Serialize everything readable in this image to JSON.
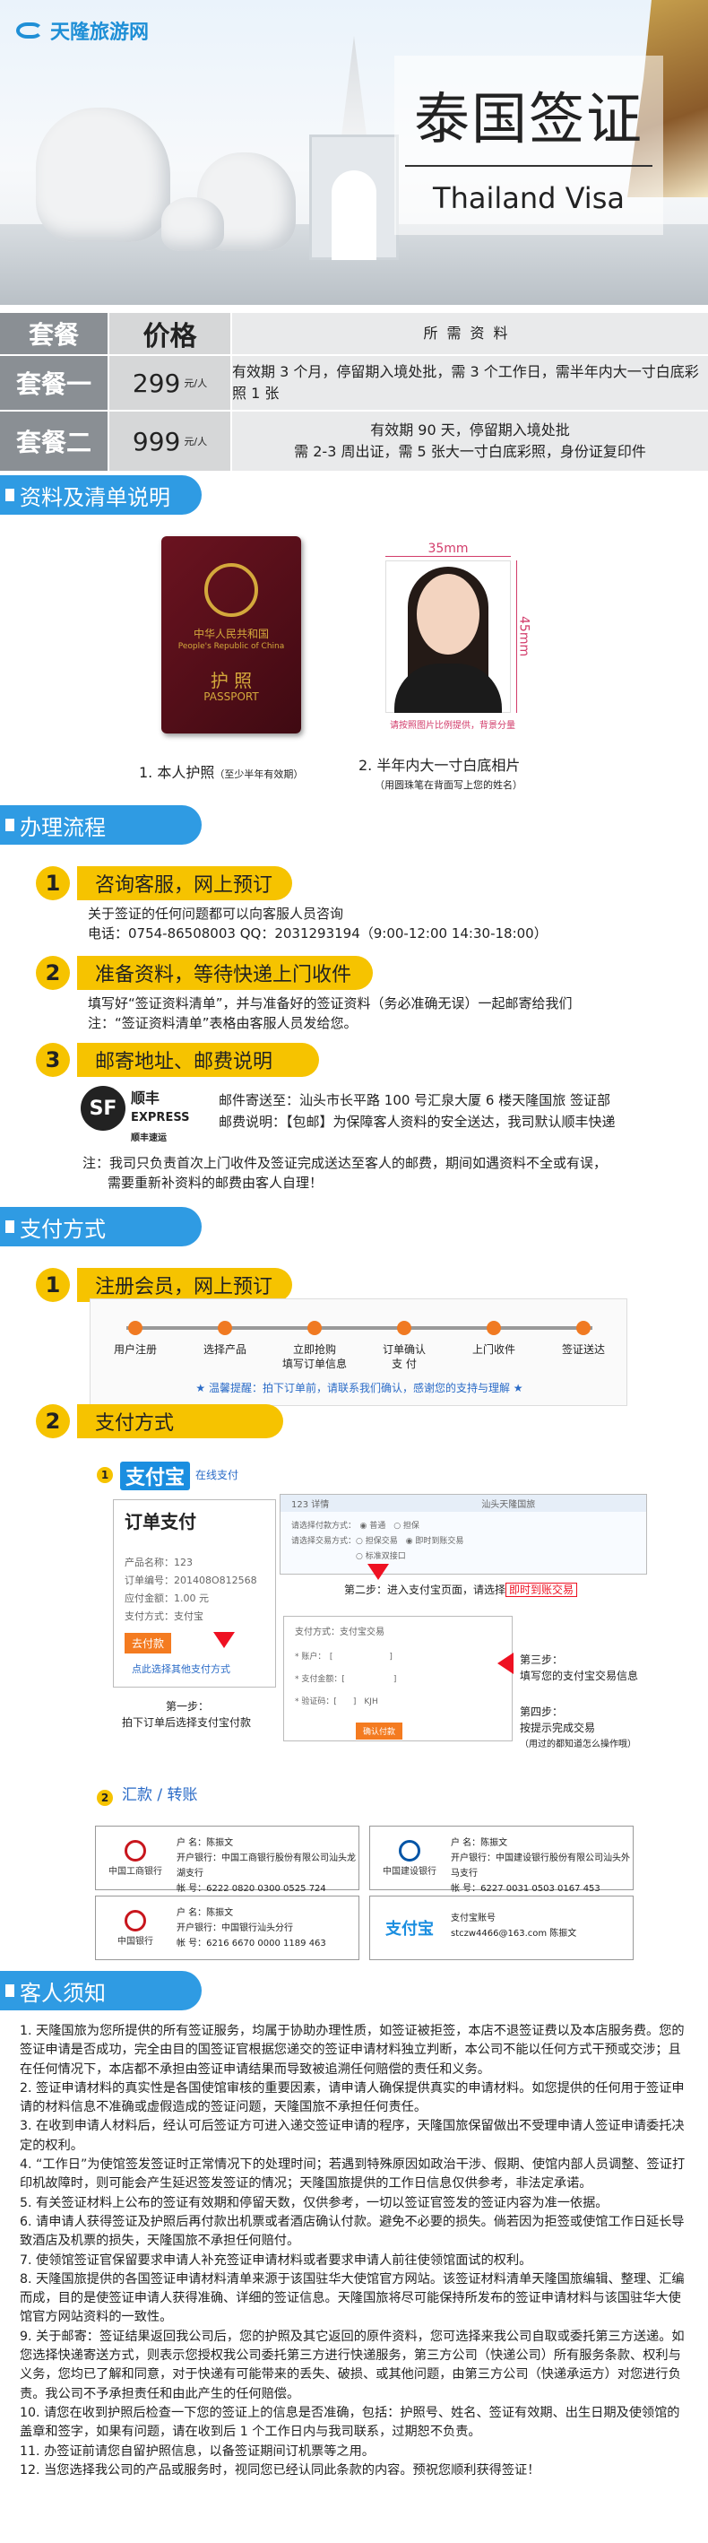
{
  "header": {
    "logo_text": "天隆旅游网",
    "title_cn": "泰国签证",
    "title_en": "Thailand Visa"
  },
  "price_table": {
    "headers": [
      "套餐",
      "价格",
      "所需资料"
    ],
    "rows": [
      {
        "name": "套餐一",
        "price": "299",
        "unit": "元/人",
        "materials": [
          "有效期 3 个月，停留期入境处批，需 3 个工作日，需半年内大一寸白底彩照 1 张"
        ]
      },
      {
        "name": "套餐二",
        "price": "999",
        "unit": "元/人",
        "materials": [
          "有效期 90 天，停留期入境处批",
          "需 2-3 周出证，需 5 张大一寸白底彩照，身份证复印件"
        ]
      }
    ]
  },
  "section1": {
    "title": "资料及清单说明",
    "passport_label_cn": "中华人民共和国",
    "passport_label_en": "People's Republic of China",
    "passport_word": "护 照",
    "passport_word_en": "PASSPORT",
    "photo_width": "35mm",
    "photo_height": "45mm",
    "photo_note": "请按照图片比例提供，背景分量",
    "cap1": "1. 本人护照",
    "cap1_small": "（至少半年有效期）",
    "cap2": "2. 半年内大一寸白底相片",
    "cap2_small": "（用圆珠笔在背面写上您的姓名）"
  },
  "section2": {
    "title": "办理流程",
    "steps": [
      {
        "num": "1",
        "label": "咨询客服，网上预订",
        "lines": [
          "关于签证的任何问题都可以向客服人员咨询",
          "电话：0754-86508003   QQ：2031293194（9:00-12:00  14:30-18:00）"
        ]
      },
      {
        "num": "2",
        "label": "准备资料，等待快递上门收件",
        "lines": [
          "填写好“签证资料清单”，并与准备好的签证资料（务必准确无误）一起邮寄给我们",
          "注：“签证资料清单”表格由客服人员发给您。"
        ]
      },
      {
        "num": "3",
        "label": "邮寄地址、邮费说明",
        "lines": [
          "邮件寄送至：汕头市长平路 100 号汇泉大厦 6 楼天隆国旅 签证部",
          "邮费说明：【包邮】为保障客人资料的安全送达，我司默认顺丰快递"
        ]
      }
    ],
    "sf_logo": "SF",
    "sf_name1": "顺丰",
    "sf_name2": "EXPRESS",
    "sf_name3": "顺丰速运",
    "note1": "注：我司只负责首次上门收件及签证完成送达至客人的邮费，期间如遇资料不全或有误，",
    "note2": "需要重新补资料的邮费由客人自理！"
  },
  "section3": {
    "title": "支付方式",
    "step1": {
      "num": "1",
      "label": "注册会员，网上预订"
    },
    "flow": [
      {
        "label": "用户注册"
      },
      {
        "label": "选择产品"
      },
      {
        "label": "立即抢购\n填写订单信息"
      },
      {
        "label": "订单确认\n支 付"
      },
      {
        "label": "上门收件"
      },
      {
        "label": "签证送达"
      }
    ],
    "flow_tip": "★ 温馨提醒：拍下订单前，请联系我们确认，感谢您的支持与理解 ★",
    "step2": {
      "num": "2",
      "label": "支付方式"
    },
    "sub1": {
      "num": "1",
      "logo": "支付宝",
      "label": "在线支付"
    },
    "order": {
      "title": "订单支付",
      "rows": [
        "产品名称：123",
        "订单编号：201408O812568",
        "应付金额：1.00 元",
        "支付方式：支付宝"
      ],
      "btn": "去付款",
      "link": "点此选择其他支付方式"
    },
    "first_step": {
      "title": "第一步：",
      "desc": "拍下订单后选择支付宝付款"
    },
    "second_step": {
      "title": "第二步：进入支付宝页面，请选择",
      "highlight": "即时到账交易"
    },
    "third_step": {
      "title": "第三步：",
      "desc": "填写您的支付宝交易信息"
    },
    "fourth_step": {
      "title": "第四步：",
      "desc": "按提示完成交易",
      "note": "（用过的都知道怎么操作哦）"
    },
    "sub2": {
      "num": "2",
      "label": "汇款 / 转账"
    },
    "banks": [
      {
        "name": "中国工商银行",
        "payee": "户    名：陈振文",
        "bank": "开户银行：中国工商银行股份有限公司汕头龙湖支行",
        "account": "帐    号：6222 0820 0300 0525 724"
      },
      {
        "name": "中国建设银行",
        "payee": "户    名：陈振文",
        "bank": "开户银行：中国建设银行股份有限公司汕头外马支行",
        "account": "帐    号：6227 0031 0503 0167 453"
      },
      {
        "name": "中国银行",
        "payee": "户    名：陈振文",
        "bank": "开户银行：中国银行汕头分行",
        "account": "帐    号：6216 6670 0000 1189 463"
      },
      {
        "name": "支付宝",
        "payee": "支付宝账号",
        "bank": "stczw4466@163.com  陈振文",
        "account": ""
      }
    ]
  },
  "section4": {
    "title": "客人须知",
    "notes": [
      "1. 天隆国旅为您所提供的所有签证服务，均属于协助办理性质，如签证被拒签，本店不退签证费以及本店服务费。您的签证申请是否成功，完全由目的国签证官根据您递交的签证申请材料独立判断，本公司不能以任何方式干预或交涉；且在任何情况下，本店都不承担由签证申请结果而导致被追溯任何赔偿的责任和义务。",
      "2. 签证申请材料的真实性是各国使馆审核的重要因素，请申请人确保提供真实的申请材料。如您提供的任何用于签证申请的材料信息不准确或虚假造成的签证问题，天隆国旅不承担任何责任。",
      "3. 在收到申请人材料后，经认可后签证方可进入递交签证申请的程序，天隆国旅保留做出不受理申请人签证申请委托决定的权利。",
      "4. “工作日”为使馆签发签证时正常情况下的处理时间；若遇到特殊原因如政治干涉、假期、使馆内部人员调整、签证打印机故障时，则可能会产生延迟签发签证的情况；天隆国旅提供的工作日信息仅供参考，非法定承诺。",
      "5. 有关签证材料上公布的签证有效期和停留天数，仅供参考，一切以签证官签发的签证内容为准一依据。",
      "6. 请申请人获得签证及护照后再付款出机票或者酒店确认付款。避免不必要的损失。倘若因为拒签或使馆工作日延长导致酒店及机票的损失，天隆国旅不承担任何赔付。",
      "7. 使领馆签证官保留要求申请人补充签证申请材料或者要求申请人前往使领馆面试的权利。",
      "8. 天隆国旅提供的各国签证申请材料清单来源于该国驻华大使馆官方网站。该签证材料清单天隆国旅编辑、整理、汇编而成，目的是使签证申请人获得准确、详细的签证信息。天隆国旅将尽可能保持所发布的签证申请材料与该国驻华大使馆官方网站资料的一致性。",
      "9. 关于邮寄：签证结果返回我公司后，您的护照及其它返回的原件资料，您可选择来我公司自取或委托第三方送递。如您选择快递寄送方式，则表示您授权我公司委托第三方进行快递服务，第三方公司（快递公司）所有服务条款、权利与义务，您均已了解和同意，对于快递有可能带来的丢失、破损、或其他问题，由第三方公司（快递承运方）对您进行负责。我公司不予承担责任和由此产生的任何赔偿。",
      "10. 请您在收到护照后检查一下您的签证上的信息是否准确，包括：护照号、姓名、签证有效期、出生日期及使领馆的盖章和签字，如果有问题，请在收到后 1 个工作日内与我司联系，过期恕不负责。",
      "11. 办签证前请您自留护照信息，以备签证期间订机票等之用。",
      "12. 当您选择我公司的产品或服务时，视同您已经认同此条款的内容。预祝您顺利获得签证！"
    ]
  }
}
